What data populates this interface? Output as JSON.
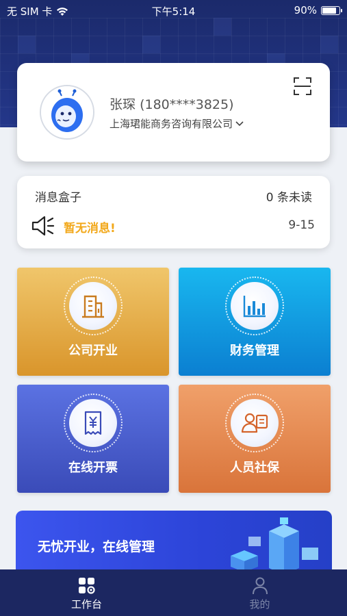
{
  "status_bar": {
    "carrier": "无 SIM 卡",
    "time": "下午5:14",
    "battery_text": "90%",
    "battery_level": 0.9,
    "icons": [
      "wifi-icon",
      "battery-icon"
    ]
  },
  "profile": {
    "name": "张琛",
    "phone": "(180****3825)",
    "company": "上海珺能商务咨询有限公司",
    "icons": [
      "avatar-mascot-icon",
      "chevron-down-icon",
      "scan-icon"
    ]
  },
  "messages": {
    "title": "消息盒子",
    "unread": "0 条未读",
    "empty": "暂无消息!",
    "date": "9-15",
    "icon": "speaker-icon"
  },
  "tiles": [
    {
      "label": "公司开业",
      "icon": "building-icon",
      "color": "#e4ab45"
    },
    {
      "label": "财务管理",
      "icon": "bar-chart-icon",
      "color": "#139ee3"
    },
    {
      "label": "在线开票",
      "icon": "invoice-yen-icon",
      "color": "#4a5fcf"
    },
    {
      "label": "人员社保",
      "icon": "person-insurance-icon",
      "color": "#e68950"
    }
  ],
  "banner": {
    "text": "无忧开业，在线管理",
    "illustration": "isometric-office-illustration"
  },
  "tabbar": {
    "items": [
      {
        "label": "工作台",
        "icon": "workbench-grid-icon",
        "active": true
      },
      {
        "label": "我的",
        "icon": "user-profile-icon",
        "active": false
      }
    ]
  },
  "colors": {
    "header_bg": "#1b2a6b",
    "accent_warning": "#f2a81a",
    "tabbar_bg": "#1c2761"
  }
}
